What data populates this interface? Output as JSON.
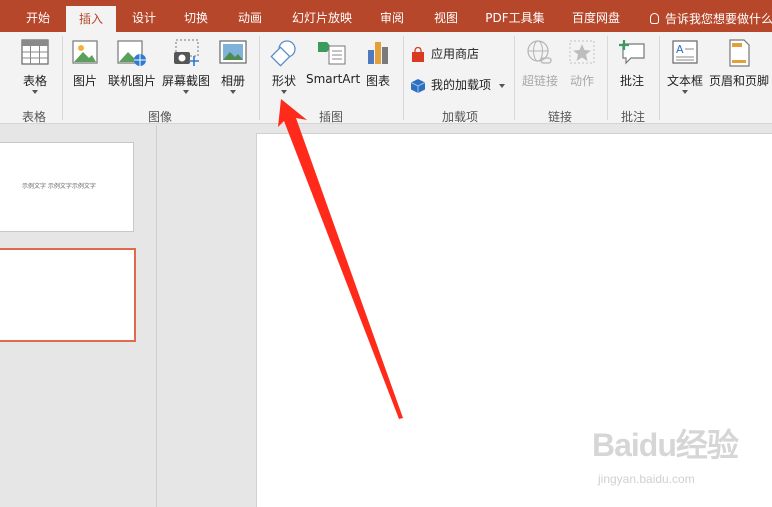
{
  "tabs": [
    {
      "label": "开始"
    },
    {
      "label": "插入",
      "active": true
    },
    {
      "label": "设计"
    },
    {
      "label": "切换"
    },
    {
      "label": "动画"
    },
    {
      "label": "幻灯片放映"
    },
    {
      "label": "审阅"
    },
    {
      "label": "视图"
    },
    {
      "label": "PDF工具集"
    },
    {
      "label": "百度网盘"
    }
  ],
  "tell_me": "告诉我您想要做什么",
  "ribbon": {
    "groups": {
      "tables": "表格",
      "images": "图像",
      "illustrations": "插图",
      "addins": "加载项",
      "links": "链接",
      "comments": "批注"
    },
    "buttons": {
      "table": "表格",
      "picture": "图片",
      "online_picture": "联机图片",
      "screenshot": "屏幕截图",
      "album": "相册",
      "shapes": "形状",
      "smartart": "SmartArt",
      "chart": "图表",
      "store": "应用商店",
      "my_addins": "我的加载项",
      "hyperlink": "超链接",
      "action": "动作",
      "comment": "批注",
      "textbox": "文本框",
      "header_footer": "页眉和页脚"
    }
  },
  "thumbnail_text": "示例文字 示例文字示例文字",
  "watermark": {
    "main": "Baidu经验",
    "sub": "jingyan.baidu.com"
  },
  "colors": {
    "accent": "#b7472a",
    "arrow": "#ff2a1a",
    "selection": "#e06a4e"
  }
}
